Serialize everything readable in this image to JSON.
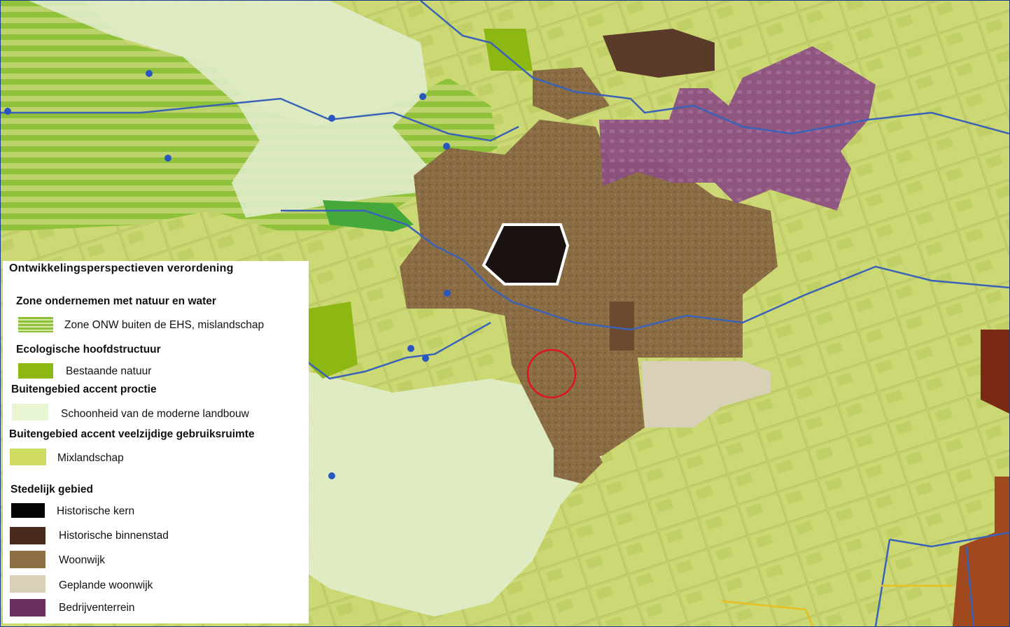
{
  "legend": {
    "title": "Ontwikkelingsperspectieven verordening",
    "sections": [
      {
        "heading": "Zone ondernemen met natuur en water",
        "items": [
          {
            "label": "Zone ONW buiten de EHS, mislandschap",
            "swatch": "striped-green",
            "color": "#8fc23a"
          }
        ]
      },
      {
        "heading": "Ecologische hoofdstructuur",
        "items": [
          {
            "label": "Bestaande natuur",
            "swatch": "solid",
            "color": "#8db814"
          }
        ]
      },
      {
        "heading": "Buitengebied accent proctie",
        "items": [
          {
            "label": "Schoonheid van de moderne landbouw",
            "swatch": "solid",
            "color": "#e8f5d2"
          }
        ]
      },
      {
        "heading": "Buitengebied accent veelzijdige gebruiksruimte",
        "items": [
          {
            "label": "Mixlandschap",
            "swatch": "solid",
            "color": "#cfdb5e"
          }
        ]
      },
      {
        "heading": "Stedelijk gebied",
        "items": [
          {
            "label": "Historische kern",
            "swatch": "solid",
            "color": "#050505"
          },
          {
            "label": "Historische binnenstad",
            "swatch": "solid",
            "color": "#4a2a1c"
          },
          {
            "label": "Woonwijk",
            "swatch": "solid",
            "color": "#8c6f42"
          },
          {
            "label": "Geplande woonwijk",
            "swatch": "solid",
            "color": "#d9d0b8"
          },
          {
            "label": "Bedrijventerrein",
            "swatch": "solid",
            "color": "#6b2d5e"
          }
        ]
      }
    ]
  },
  "colors": {
    "frame_border": "#1a3a8a",
    "water": "#3a63b8",
    "highlight_circle": "#e0141e",
    "historic_core_outline": "#ffffff"
  }
}
